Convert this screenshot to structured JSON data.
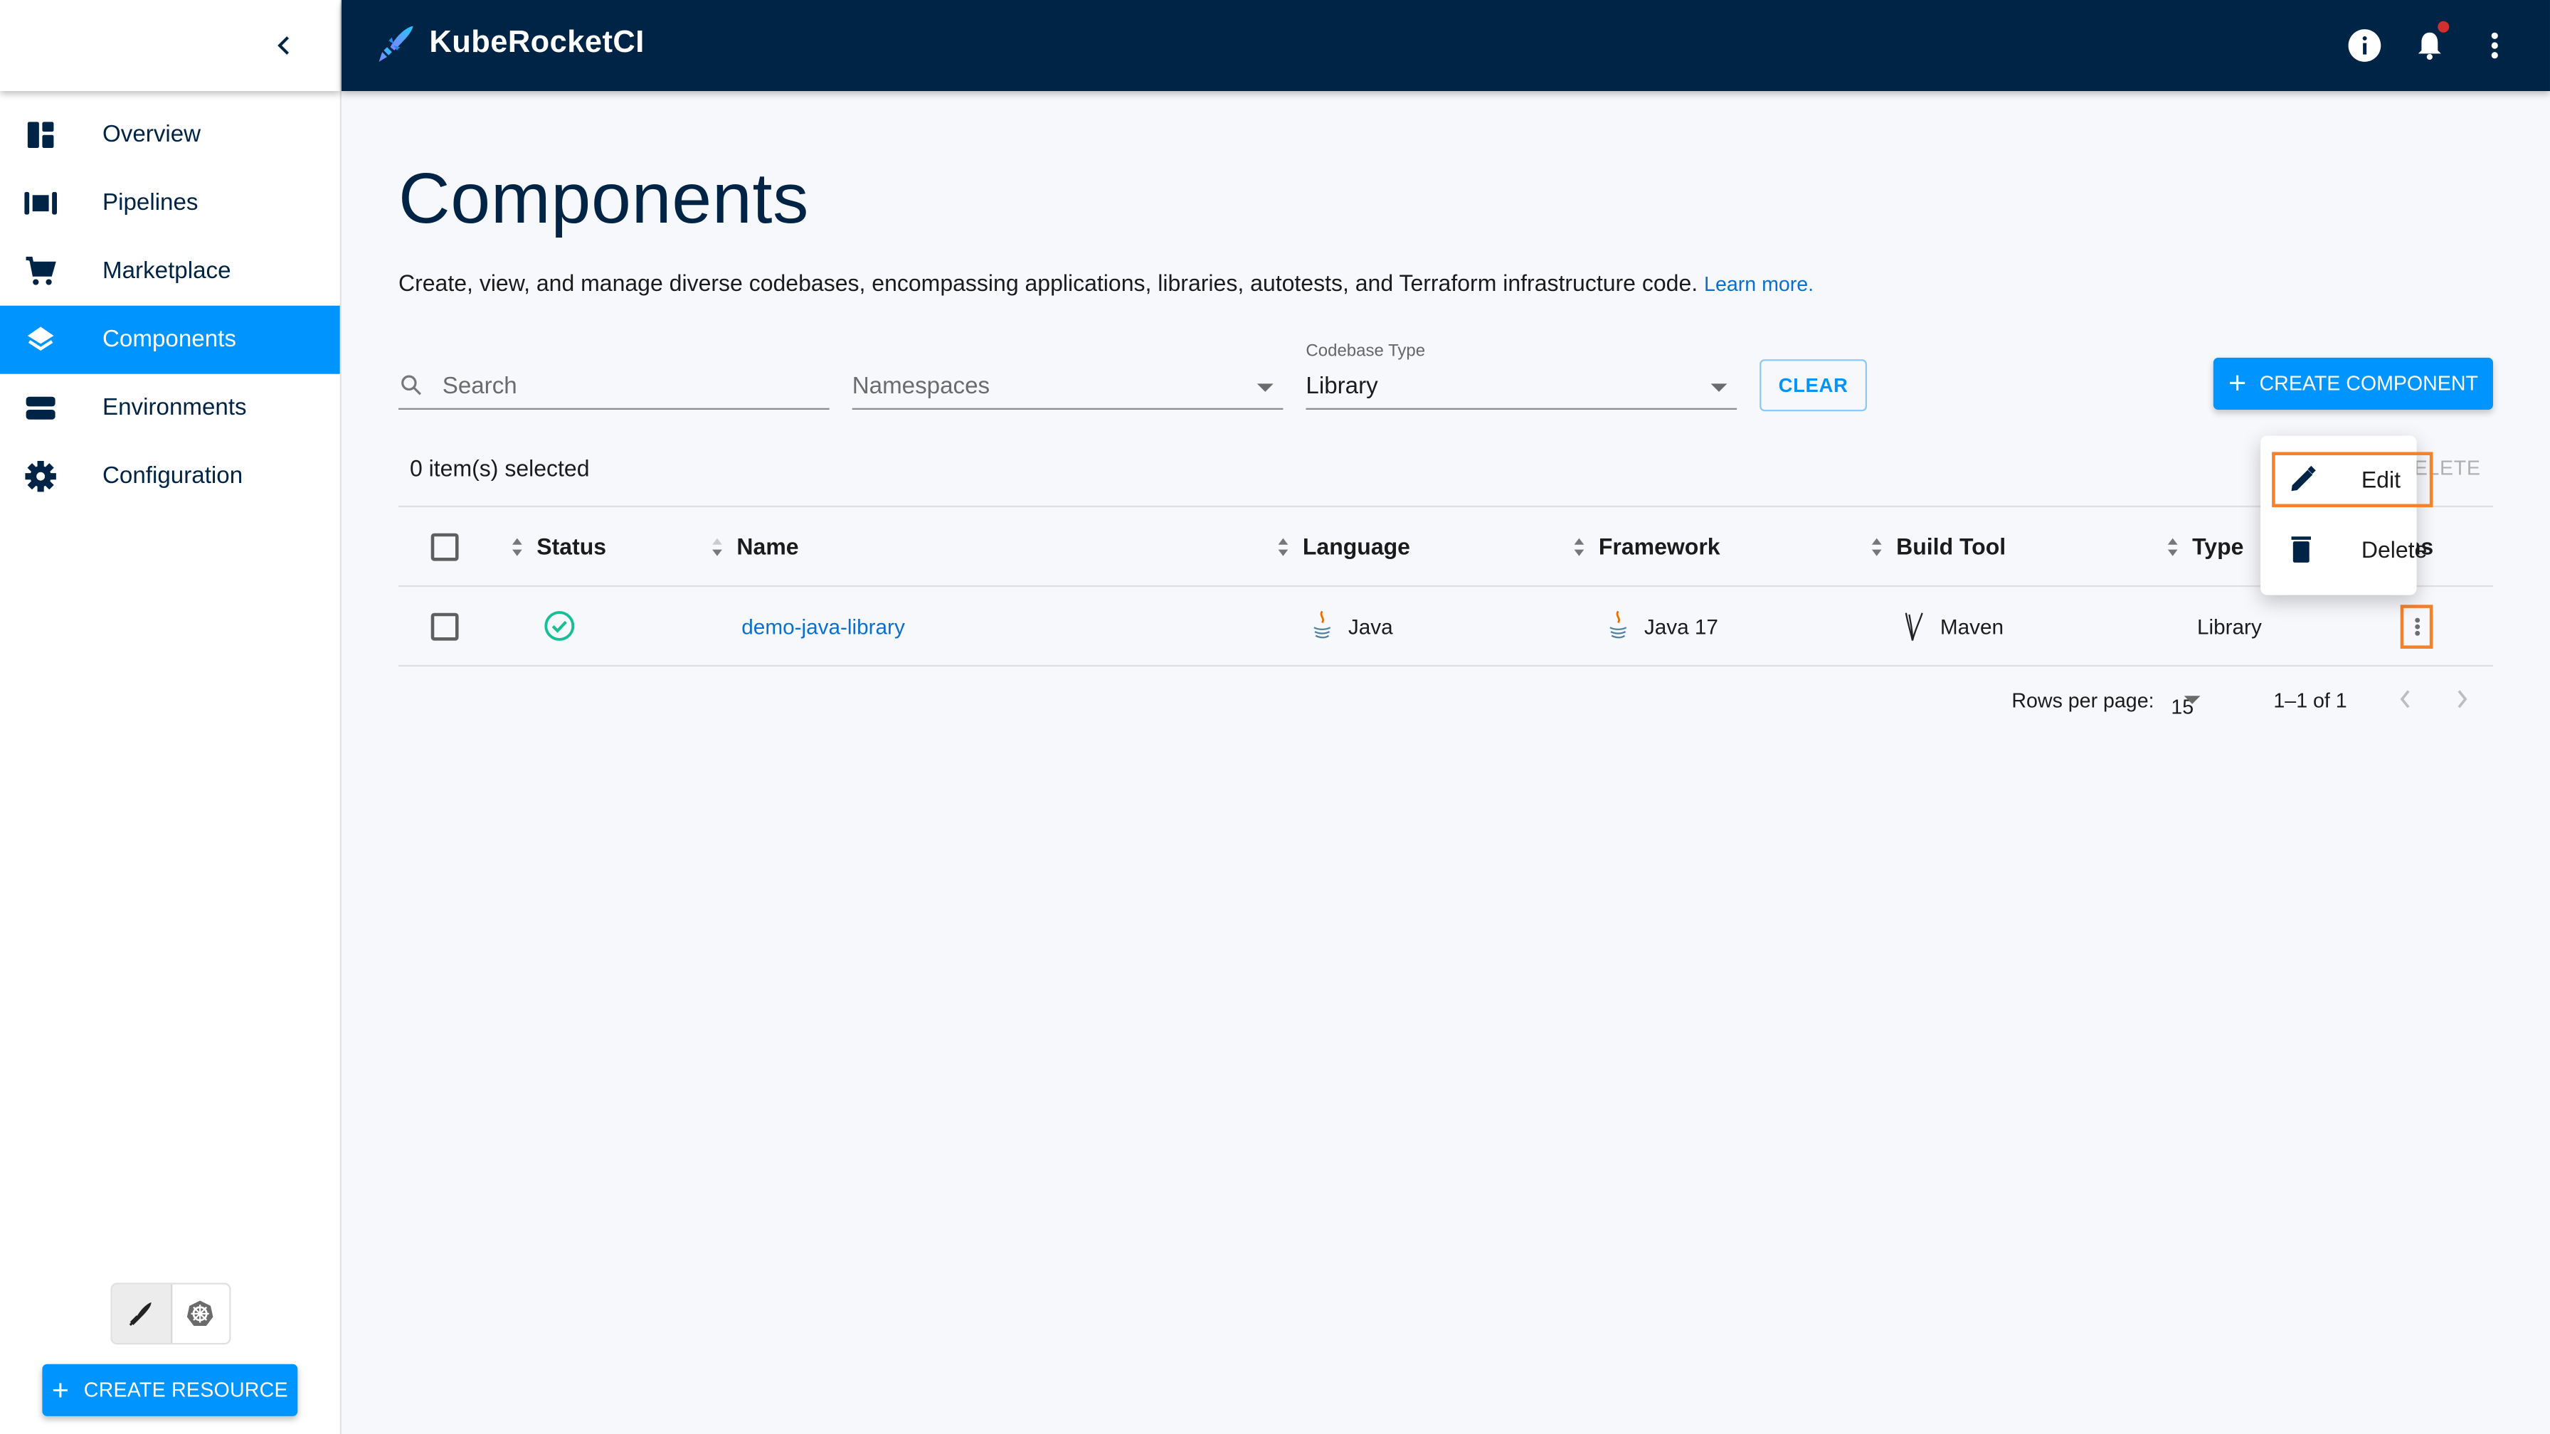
{
  "sidebar": {
    "collapse_icon": "chevron-left-icon",
    "items": [
      {
        "label": "Overview",
        "icon": "dashboard-icon",
        "active": false
      },
      {
        "label": "Pipelines",
        "icon": "pipelines-icon",
        "active": false
      },
      {
        "label": "Marketplace",
        "icon": "cart-icon",
        "active": false
      },
      {
        "label": "Components",
        "icon": "layers-icon",
        "active": true
      },
      {
        "label": "Environments",
        "icon": "environments-icon",
        "active": false
      },
      {
        "label": "Configuration",
        "icon": "gear-icon",
        "active": false
      }
    ],
    "mode_toggle": [
      "krci-rocket-icon",
      "kubernetes-icon"
    ],
    "create_resource_label": "CREATE RESOURCE"
  },
  "header": {
    "brand": "KubeRocketCI",
    "icons": [
      "info-icon",
      "notifications-bell-icon",
      "more-vert-icon"
    ],
    "has_notification_badge": true
  },
  "page": {
    "title": "Components",
    "description": "Create, view, and manage diverse codebases, encompassing applications, libraries, autotests, and Terraform infrastructure code.",
    "learn_more": "Learn more."
  },
  "filters": {
    "search_placeholder": "Search",
    "namespaces_placeholder": "Namespaces",
    "codebase_type_label": "Codebase Type",
    "codebase_type_value": "Library",
    "clear_label": "CLEAR",
    "create_component_label": "CREATE COMPONENT"
  },
  "selection": {
    "selected_text": "0 item(s) selected",
    "delete_label": "DELETE"
  },
  "table": {
    "columns": [
      "Status",
      "Name",
      "Language",
      "Framework",
      "Build Tool",
      "Type",
      "Actions"
    ],
    "rows": [
      {
        "status": "success",
        "name": "demo-java-library",
        "language": "Java",
        "framework": "Java 17",
        "build_tool": "Maven",
        "type": "Library"
      }
    ]
  },
  "pagination": {
    "rows_per_page_label": "Rows per page:",
    "rows_per_page": "15",
    "range": "1–1 of 1"
  },
  "context_menu": {
    "items": [
      {
        "label": "Edit",
        "icon": "pencil-icon",
        "highlighted": true
      },
      {
        "label": "Delete",
        "icon": "trash-icon",
        "highlighted": false
      }
    ]
  },
  "colors": {
    "accent": "#0094ff",
    "header_bg": "#002446",
    "highlight": "#f5822a",
    "success": "#18be94",
    "link": "#0a6fcf"
  }
}
